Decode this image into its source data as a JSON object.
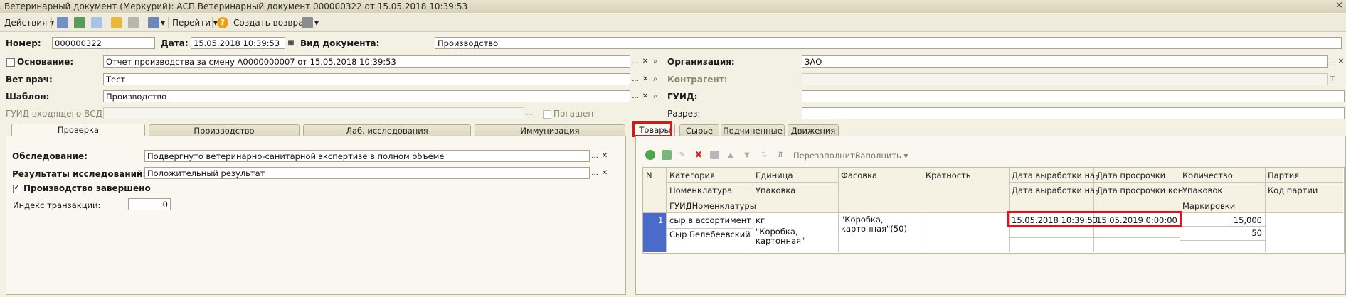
{
  "window": {
    "title": "Ветеринарный документ (Меркурий): АСП Ветеринарный документ 000000322 от 15.05.2018 10:39:53",
    "close": "×"
  },
  "toolbar": {
    "actions": "Действия",
    "go": "Перейти",
    "help": "?",
    "create_return": "Создать возврат",
    "print_arrow": "▾"
  },
  "header": {
    "number_label": "Номер:",
    "number_value": "000000322",
    "date_label": "Дата:",
    "date_value": "15.05.2018 10:39:53",
    "doctype_label": "Вид документа:",
    "doctype_value": "Производство"
  },
  "left": {
    "basis_label": "Основание:",
    "basis_value": "Отчет производства за смену А0000000007 от 15.05.2018 10:39:53",
    "vet_label": "Вет врач:",
    "vet_value": "Тест",
    "template_label": "Шаблон:",
    "template_value": "Производство",
    "guid_in_label": "ГУИД входящего ВСД:",
    "guid_in_value": "",
    "repaid_label": "Погашен"
  },
  "right": {
    "org_label": "Организация:",
    "org_value": "ЗАО",
    "contractor_label": "Контрагент:",
    "contractor_value": "",
    "guid_label": "ГУИД:",
    "guid_value": "",
    "section_label": "Разрез:",
    "section_value": ""
  },
  "left_tabs": [
    "Проверка",
    "Производство",
    "Лаб. исследования",
    "Иммунизация"
  ],
  "check_tab": {
    "exam_label": "Обследование:",
    "exam_value": "Подвергнуто ветеринарно-санитарной экспертизе в полном объёме",
    "results_label": "Результаты исследований:",
    "results_value": "Положительный результат",
    "finished_label": "Производство завершено",
    "txn_label": "Индекс транзакции:",
    "txn_value": "0"
  },
  "right_tabs": [
    "Товары",
    "Сырье",
    "Подчиненные",
    "Движения"
  ],
  "goods_toolbar": {
    "refill": "Перезаполнить",
    "fill": "Заполнить"
  },
  "grid": {
    "headers": {
      "n": "N",
      "cat": "Категория",
      "nom": "Номенклатура",
      "guidnom": "ГУИДНоменклатуры",
      "unit": "Единица",
      "pack": "Упаковка",
      "fas": "Фасовка",
      "mult": "Кратность",
      "prod_start": "Дата выработки нач.",
      "prod_start2": "Дата выработки нач.",
      "exp": "Дата просрочки",
      "exp_end": "Дата просрочки кон.",
      "qty": "Количество",
      "packs": "Упаковок",
      "marks": "Маркировки",
      "batch": "Партия",
      "batch_code": "Код партии"
    },
    "row": {
      "n": "1",
      "cat": "сыр в ассортимент...",
      "nom": "Сыр  Белебеевский...",
      "unit": "кг",
      "pack": "\"Коробка, картонная\"",
      "fas": "\"Коробка, картонная\"(50)",
      "prod_start": "15.05.2018 10:39:53",
      "exp": "15.05.2019 0:00:00",
      "qty": "15,000",
      "packs": "50"
    }
  }
}
